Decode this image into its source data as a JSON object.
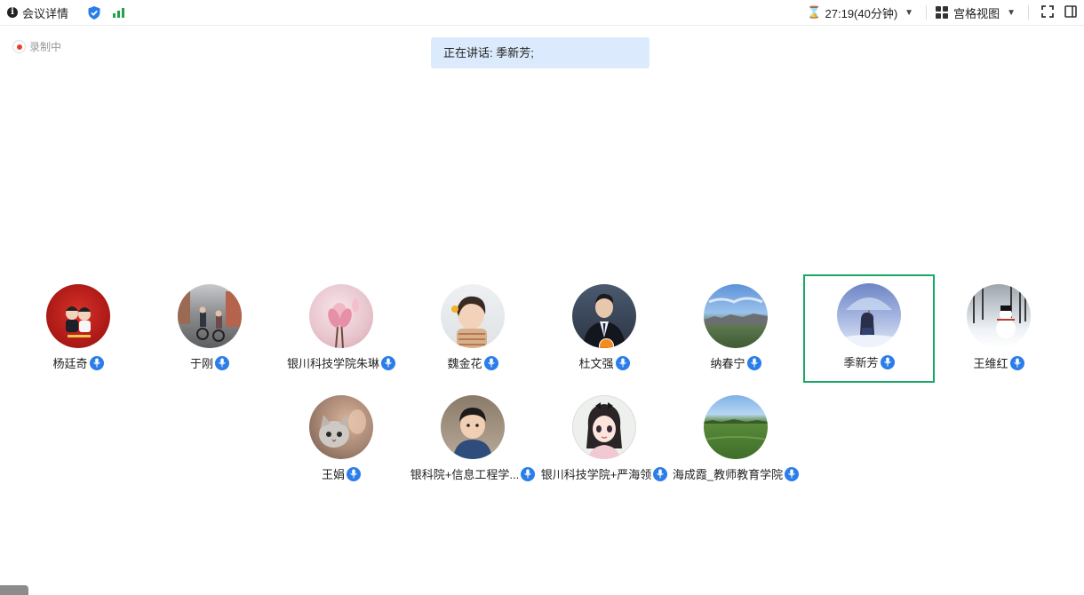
{
  "header": {
    "meeting_details_label": "会议详情",
    "timer": "27:19(40分钟)",
    "view_label": "宫格视图"
  },
  "recording": {
    "label": "录制中"
  },
  "speaking": {
    "text": "正在讲话: 季新芳;"
  },
  "participants": [
    {
      "name": "杨廷奇",
      "icon": "couple-illustration",
      "active": false
    },
    {
      "name": "于刚",
      "icon": "cyclists-photo",
      "active": false
    },
    {
      "name": "银川科技学院朱琳",
      "icon": "magnolia-photo",
      "active": false
    },
    {
      "name": "魏金花",
      "icon": "child-photo",
      "active": false
    },
    {
      "name": "杜文强",
      "icon": "man-in-suit-photo",
      "host": true,
      "active": false
    },
    {
      "name": "纳春宁",
      "icon": "sky-landscape-photo",
      "active": false
    },
    {
      "name": "季新芳",
      "icon": "umbrella-girl-illustration",
      "active": true
    },
    {
      "name": "王维红",
      "icon": "snowman-photo",
      "active": false
    },
    {
      "name": "王娟",
      "icon": "kitten-photo",
      "active": false
    },
    {
      "name": "银科院+信息工程学...",
      "icon": "boy-photo",
      "active": false
    },
    {
      "name": "银川科技学院+严海领",
      "icon": "cartoon-girl-illustration",
      "active": false
    },
    {
      "name": "海成霞_教师教育学院",
      "icon": "green-field-photo",
      "active": false
    }
  ],
  "colors": {
    "mic_blue": "#2b7de9",
    "active_border": "#18a965",
    "speaking_bg": "#dbeafc",
    "signal_green": "#1fa34b",
    "recording_red": "#e8412c"
  }
}
